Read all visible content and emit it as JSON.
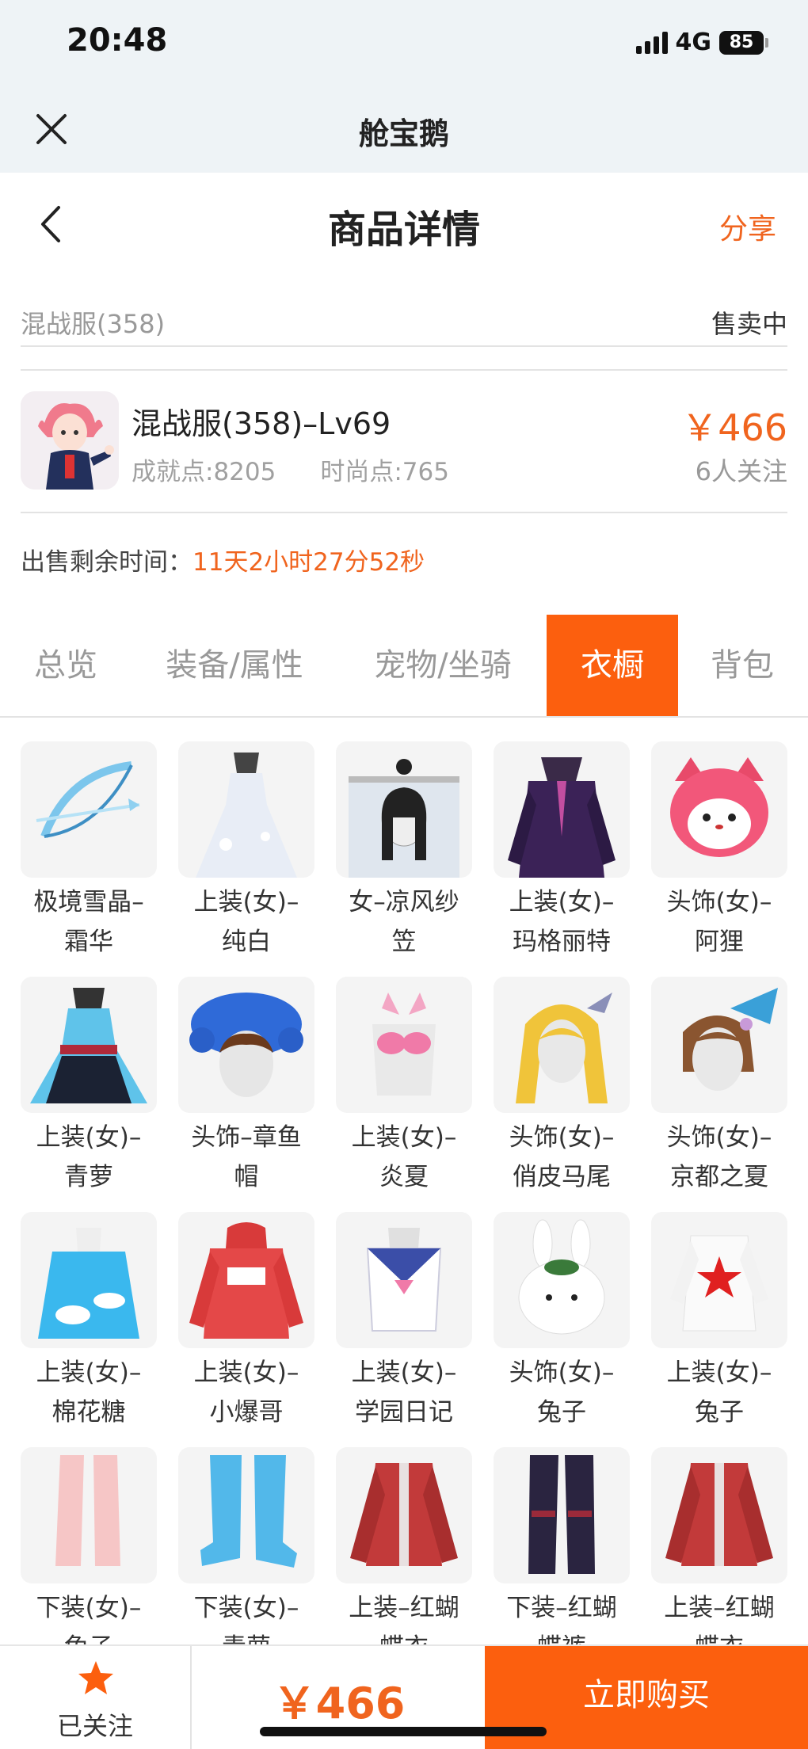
{
  "status_bar": {
    "time": "20:48",
    "network": "4G",
    "battery": "85"
  },
  "app_bar": {
    "title": "舱宝鹅"
  },
  "nav": {
    "title": "商品详情",
    "share": "分享"
  },
  "server": {
    "name": "混战服(358)",
    "status": "售卖中"
  },
  "product": {
    "name": "混战服(358)–Lv69",
    "achievement": "成就点:8205",
    "fashion": "时尚点:765",
    "price": "￥466",
    "followers": "6人关注"
  },
  "remaining": {
    "label": "出售剩余时间：",
    "value": "11天2小时27分52秒"
  },
  "tabs": [
    "总览",
    "装备/属性",
    "宠物/坐骑",
    "衣橱",
    "背包"
  ],
  "active_tab": "衣橱",
  "wardrobe": [
    {
      "line1": "极境雪晶–",
      "line2": "霜华",
      "icon": "ice-bow-icon"
    },
    {
      "line1": "上装(女)–",
      "line2": "纯白",
      "icon": "white-dress-icon"
    },
    {
      "line1": "女–凉风纱",
      "line2": "笠",
      "icon": "veil-hat-icon"
    },
    {
      "line1": "上装(女)–",
      "line2": "玛格丽特",
      "icon": "purple-outfit-icon"
    },
    {
      "line1": "头饰(女)–",
      "line2": "阿狸",
      "icon": "fox-head-icon"
    },
    {
      "line1": "上装(女)–",
      "line2": "青萝",
      "icon": "blue-dress-icon"
    },
    {
      "line1": "头饰–章鱼",
      "line2": "帽",
      "icon": "octopus-hat-icon"
    },
    {
      "line1": "上装(女)–",
      "line2": "炎夏",
      "icon": "pink-bikini-icon"
    },
    {
      "line1": "头饰(女)–",
      "line2": "俏皮马尾",
      "icon": "blonde-hair-icon"
    },
    {
      "line1": "头饰(女)–",
      "line2": "京都之夏",
      "icon": "fan-hair-icon"
    },
    {
      "line1": "上装(女)–",
      "line2": "棉花糖",
      "icon": "cloud-dress-icon"
    },
    {
      "line1": "上装(女)–",
      "line2": "小爆哥",
      "icon": "red-hoodie-icon"
    },
    {
      "line1": "上装(女)–",
      "line2": "学园日记",
      "icon": "sailor-uniform-icon"
    },
    {
      "line1": "头饰(女)–",
      "line2": "兔子",
      "icon": "bunny-head-icon"
    },
    {
      "line1": "上装(女)–",
      "line2": "兔子",
      "icon": "white-suit-icon"
    },
    {
      "line1": "下装(女)–",
      "line2": "兔子",
      "icon": "pink-boots-icon"
    },
    {
      "line1": "下装(女)–",
      "line2": "青萝",
      "icon": "blue-boots-icon"
    },
    {
      "line1": "上装–红蝴",
      "line2": "蝶衣",
      "icon": "red-armor-icon"
    },
    {
      "line1": "下装–红蝴",
      "line2": "蝶裤",
      "icon": "dark-legs-icon"
    },
    {
      "line1": "上装–红蝴",
      "line2": "蝶衣",
      "icon": "red-armor-icon"
    }
  ],
  "bottom": {
    "follow_label": "已关注",
    "price": "￥466",
    "buy_label": "立即购买"
  },
  "colors": {
    "accent": "#fc5f0e",
    "price": "#f0641e"
  }
}
